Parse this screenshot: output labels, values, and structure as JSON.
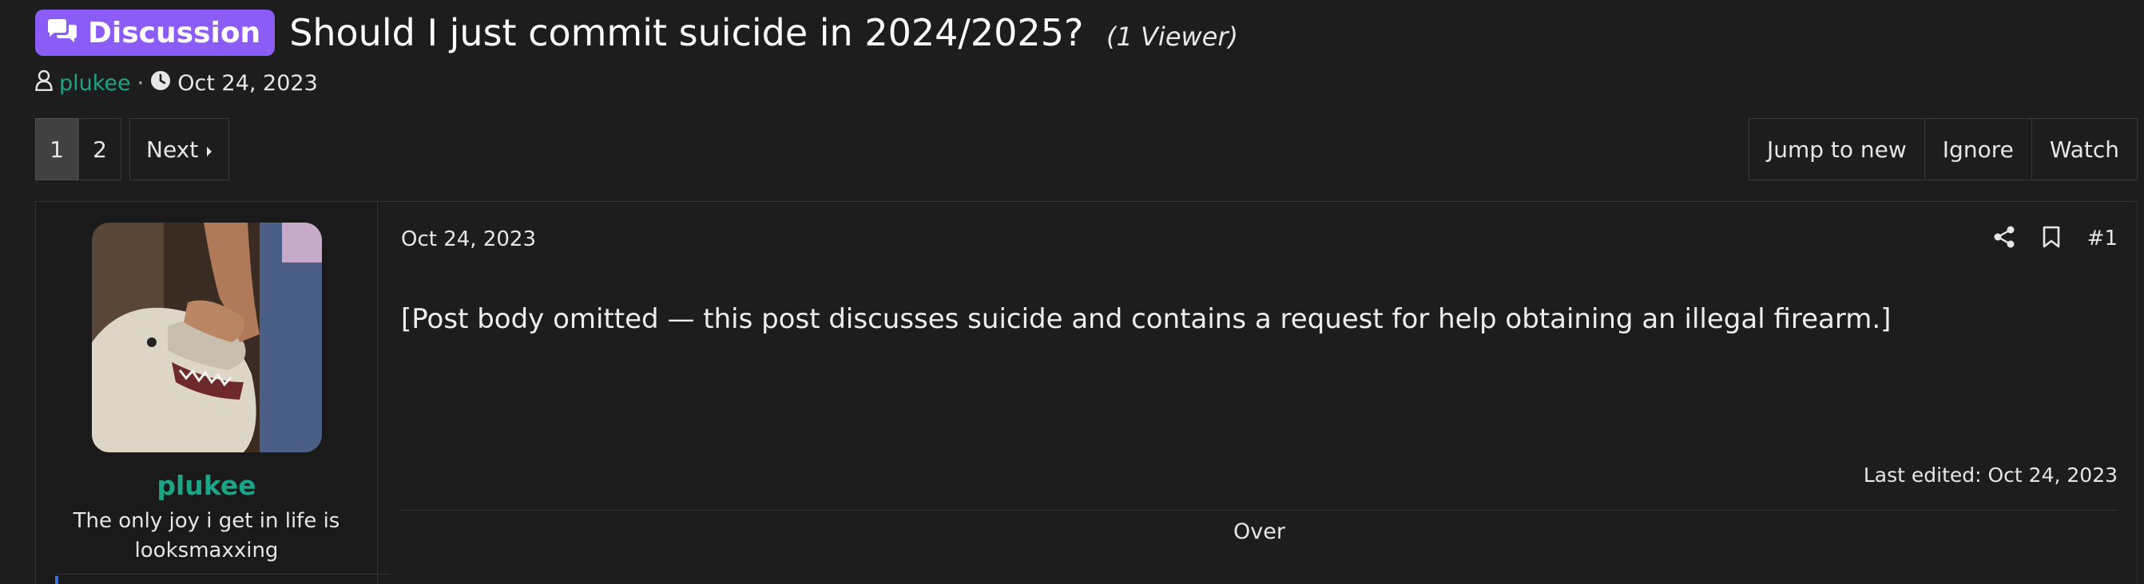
{
  "thread": {
    "prefix": "Discussion",
    "title": "Should I just commit suicide in 2024/2025?",
    "viewers": "(1 Viewer)",
    "author": "plukee",
    "separator": "·",
    "date": "Oct 24, 2023"
  },
  "pagination": {
    "pages": [
      "1",
      "2"
    ],
    "current": "1",
    "next_label": "Next"
  },
  "thread_actions": [
    "Jump to new",
    "Ignore",
    "Watch"
  ],
  "post": {
    "user": {
      "name": "plukee",
      "title": "The only joy i get in life is looksmaxxing"
    },
    "date": "Oct 24, 2023",
    "number": "#1",
    "body": "[Post body omitted — this post discusses suicide and contains a request for help obtaining an illegal firearm.]",
    "last_edited": "Last edited: Oct 24, 2023",
    "signature": "Over"
  },
  "icons": {
    "badge": "chat-bubbles-icon",
    "author": "user-icon",
    "date": "clock-icon",
    "next": "caret-right-icon",
    "share": "share-icon",
    "bookmark": "bookmark-icon"
  },
  "colors": {
    "background": "#1d1d1d",
    "badge": "#8b5cf6",
    "username": "#1aa587"
  }
}
